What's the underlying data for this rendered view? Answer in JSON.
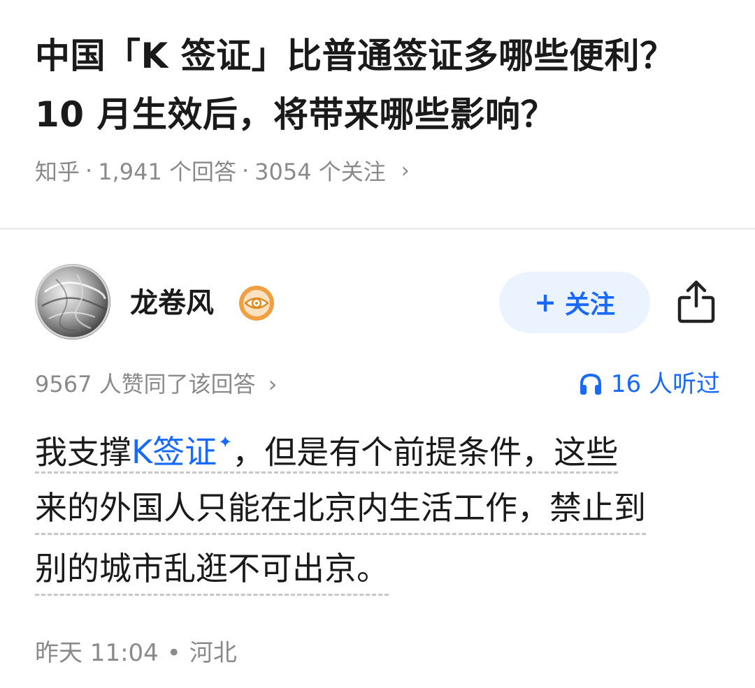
{
  "question": {
    "title": "中国「K 签证」比普通签证多哪些便利？ 10 月生效后，将带来哪些影响？",
    "source": "知乎",
    "answers_count": "1,941 个回答",
    "followers_count": "3054 个关注"
  },
  "author": {
    "name": "龙卷风",
    "badge_icon": "eye-badge-icon",
    "follow_label": "关注",
    "share_icon": "share-icon"
  },
  "stats": {
    "votes": "9567 人赞同了该回答",
    "listens": "16 人听过"
  },
  "answer": {
    "lines": [
      {
        "before": "我支撑",
        "keyword": "K签证",
        "after": "，但是有个前提条件，这些"
      },
      {
        "text": "来的外国人只能在北京内生活工作，禁止到"
      },
      {
        "text": "别的城市乱逛不可出京。"
      }
    ]
  },
  "footer": {
    "time": "昨天 11:04",
    "location": "河北"
  },
  "colors": {
    "accent": "#1769ff",
    "follow_bg": "#ebf3ff",
    "meta_text": "#8a8a8a",
    "badge_orange": "#f0a040"
  }
}
